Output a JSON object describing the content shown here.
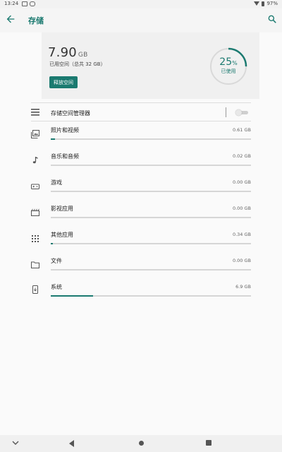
{
  "status_bar": {
    "time": "13:24",
    "battery": "97%"
  },
  "app_bar": {
    "title": "存储"
  },
  "summary": {
    "used_value": "7.90",
    "used_unit": "GB",
    "used_label": "已用空间（总共 32 GB）",
    "free_button": "释放空间",
    "percent_value": "25",
    "percent_sign": "%",
    "percent_label": "已使用",
    "percent_used": 25
  },
  "storage_manager": {
    "label": "存储空间管理器",
    "enabled": false
  },
  "categories": [
    {
      "label": "照片和视频",
      "size": "0.61 GB",
      "fraction": 0.02,
      "icon": "photo-icon"
    },
    {
      "label": "音乐和音频",
      "size": "0.02 GB",
      "fraction": 0.0,
      "icon": "music-note-icon"
    },
    {
      "label": "游戏",
      "size": "0.00 GB",
      "fraction": 0.0,
      "icon": "gamepad-icon"
    },
    {
      "label": "影视应用",
      "size": "0.00 GB",
      "fraction": 0.0,
      "icon": "movie-icon"
    },
    {
      "label": "其他应用",
      "size": "0.34 GB",
      "fraction": 0.01,
      "icon": "apps-grid-icon"
    },
    {
      "label": "文件",
      "size": "0.00 GB",
      "fraction": 0.0,
      "icon": "folder-icon"
    },
    {
      "label": "系统",
      "size": "6.9 GB",
      "fraction": 0.21,
      "icon": "system-update-icon"
    }
  ],
  "colors": {
    "accent": "#1b7a70",
    "track": "#d6d6d6",
    "background": "#fafafa"
  }
}
